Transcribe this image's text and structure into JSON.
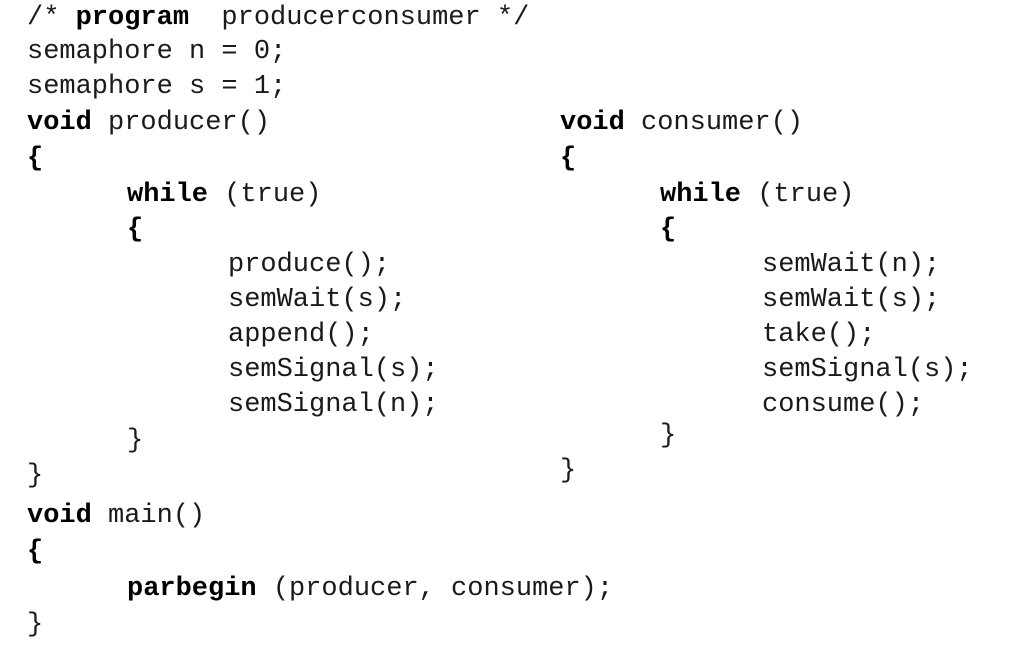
{
  "header": {
    "comment_open": "/* ",
    "comment_keyword": "program",
    "comment_rest": "  producerconsumer */"
  },
  "globals": [
    "semaphore n = 0;",
    "semaphore s = 1;"
  ],
  "producer": {
    "void_kw": "void",
    "signature": " producer()",
    "open_brace": "{",
    "while_kw": "while",
    "while_cond": " (true)",
    "loop_open": "{",
    "body": [
      "produce();",
      "semWait(s);",
      "append();",
      "semSignal(s);",
      "semSignal(n);"
    ],
    "loop_close": "}",
    "close_brace": "}"
  },
  "consumer": {
    "void_kw": "void",
    "signature": " consumer()",
    "open_brace": "{",
    "while_kw": "while",
    "while_cond": " (true)",
    "loop_open": "{",
    "body": [
      "semWait(n);",
      "semWait(s);",
      "take();",
      "semSignal(s);",
      "consume();"
    ],
    "loop_close": "}",
    "close_brace": "}"
  },
  "main": {
    "void_kw": "void",
    "signature": " main()",
    "open_brace": "{",
    "parbegin_kw": "parbegin",
    "parbegin_args": " (producer, consumer);",
    "close_brace": "}"
  }
}
